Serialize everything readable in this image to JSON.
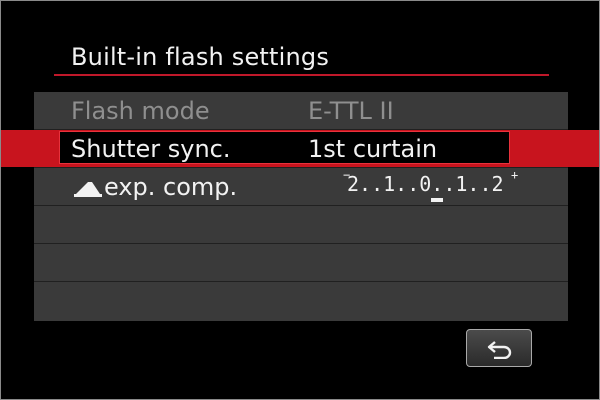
{
  "header": {
    "title": "Built-in flash settings"
  },
  "menu": {
    "items": [
      {
        "label": "Flash mode",
        "value": "E-TTL II",
        "state": "disabled"
      },
      {
        "label": "Shutter sync.",
        "value": "1st curtain",
        "state": "selected"
      },
      {
        "label": "exp. comp.",
        "icon": "flash-icon",
        "value": "-2..1..0..1..+2",
        "level": 0
      }
    ]
  },
  "footer": {
    "return_icon": "return-icon"
  },
  "colors": {
    "accent": "#c8141e",
    "background": "#000000",
    "panel": "#3a3a3a"
  }
}
